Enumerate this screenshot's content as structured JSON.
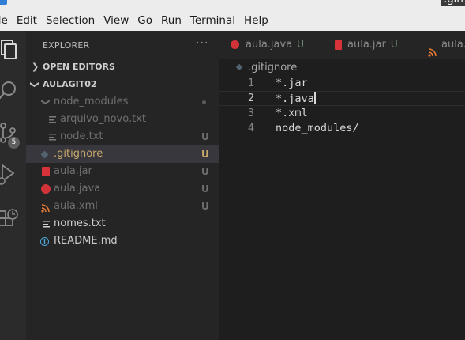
{
  "window": {
    "title": ".giti"
  },
  "menu": [
    "ile",
    "Edit",
    "Selection",
    "View",
    "Go",
    "Run",
    "Terminal",
    "Help"
  ],
  "activity": {
    "scm_badge": "5"
  },
  "sidebar": {
    "header": "EXPLORER",
    "more": "···",
    "open_editors": "OPEN EDITORS",
    "folder": "AULAGIT02",
    "items": [
      {
        "label": "node_modules",
        "status": ""
      },
      {
        "label": "arquivo_novo.txt",
        "status": ""
      },
      {
        "label": "node.txt",
        "status": "U"
      },
      {
        "label": ".gitignore",
        "status": "U"
      },
      {
        "label": "aula.jar",
        "status": "U"
      },
      {
        "label": "aula.java",
        "status": "U"
      },
      {
        "label": "aula.xml",
        "status": "U"
      },
      {
        "label": "nomes.txt",
        "status": ""
      },
      {
        "label": "README.md",
        "status": ""
      }
    ]
  },
  "tabs": [
    {
      "label": "aula.java",
      "status": "U"
    },
    {
      "label": "aula.jar",
      "status": "U"
    },
    {
      "label": "aula."
    }
  ],
  "editor": {
    "breadcrumb": ".gitignore",
    "lines": [
      {
        "num": "1",
        "text": "*.jar"
      },
      {
        "num": "2",
        "text": "*.java"
      },
      {
        "num": "3",
        "text": "*.xml"
      },
      {
        "num": "4",
        "text": "node_modules/"
      }
    ]
  },
  "colors": {
    "accent_modified": "#c9a86b",
    "java_icon": "#d13438",
    "xml_icon": "#e37933",
    "info_icon": "#4aa8d8"
  }
}
